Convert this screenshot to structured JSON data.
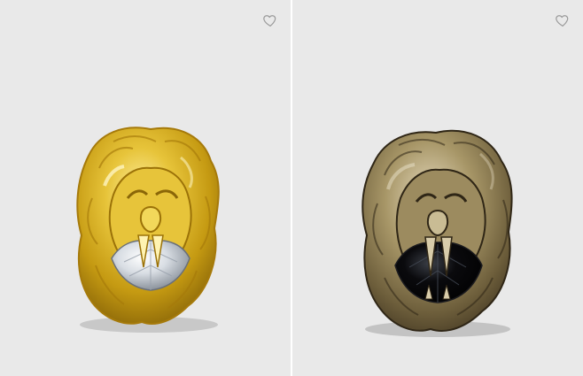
{
  "products": [
    {
      "name": "gold-lion-head-ring-with-clear-crystal",
      "wishlist_icon": "heart-outline-icon",
      "metal_color": "#d8b11f",
      "stone_color": "#cfd4da"
    },
    {
      "name": "aged-gold-lion-head-ring-with-black-crystal",
      "wishlist_icon": "heart-outline-icon",
      "metal_color": "#8b7a4f",
      "stone_color": "#0c0c10"
    }
  ],
  "colors": {
    "tile_bg": "#e9e9e9",
    "divider": "#ffffff",
    "icon": "#9a9a9a"
  }
}
